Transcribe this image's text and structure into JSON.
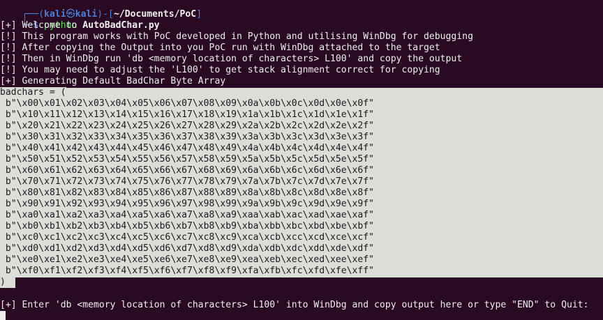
{
  "prompt": {
    "box_top_left": "┌──(",
    "user": "kali",
    "at_symbol": "㉿",
    "host": "kali",
    "box_mid": ")-[",
    "path": "~/Documents/PoC",
    "box_end": "]",
    "box_bottom": "└─",
    "dollar": "$",
    "command": "python",
    "argument": "AutoBadChar.py"
  },
  "output_lines": [
    "[+] Welcome to AutoBadChar...",
    "[!] This program works with PoC developed in Python and utilising WinDbg for debugging",
    "[!] After copying the Output into you PoC run with WinDbg attached to the target",
    "[!] Then in WinDbg run 'db <memory location of characters> L100' and copy the output",
    "[!] You may need to adjust the 'L100' to get stack alignment correct for copying",
    "[+] Generating Default BadChar Byte Array"
  ],
  "badchars_header": "badchars = (",
  "badchars_rows": [
    " b\"\\x00\\x01\\x02\\x03\\x04\\x05\\x06\\x07\\x08\\x09\\x0a\\x0b\\x0c\\x0d\\x0e\\x0f\"",
    " b\"\\x10\\x11\\x12\\x13\\x14\\x15\\x16\\x17\\x18\\x19\\x1a\\x1b\\x1c\\x1d\\x1e\\x1f\"",
    " b\"\\x20\\x21\\x22\\x23\\x24\\x25\\x26\\x27\\x28\\x29\\x2a\\x2b\\x2c\\x2d\\x2e\\x2f\"",
    " b\"\\x30\\x31\\x32\\x33\\x34\\x35\\x36\\x37\\x38\\x39\\x3a\\x3b\\x3c\\x3d\\x3e\\x3f\"",
    " b\"\\x40\\x41\\x42\\x43\\x44\\x45\\x46\\x47\\x48\\x49\\x4a\\x4b\\x4c\\x4d\\x4e\\x4f\"",
    " b\"\\x50\\x51\\x52\\x53\\x54\\x55\\x56\\x57\\x58\\x59\\x5a\\x5b\\x5c\\x5d\\x5e\\x5f\"",
    " b\"\\x60\\x61\\x62\\x63\\x64\\x65\\x66\\x67\\x68\\x69\\x6a\\x6b\\x6c\\x6d\\x6e\\x6f\"",
    " b\"\\x70\\x71\\x72\\x73\\x74\\x75\\x76\\x77\\x78\\x79\\x7a\\x7b\\x7c\\x7d\\x7e\\x7f\"",
    " b\"\\x80\\x81\\x82\\x83\\x84\\x85\\x86\\x87\\x88\\x89\\x8a\\x8b\\x8c\\x8d\\x8e\\x8f\"",
    " b\"\\x90\\x91\\x92\\x93\\x94\\x95\\x96\\x97\\x98\\x99\\x9a\\x9b\\x9c\\x9d\\x9e\\x9f\"",
    " b\"\\xa0\\xa1\\xa2\\xa3\\xa4\\xa5\\xa6\\xa7\\xa8\\xa9\\xaa\\xab\\xac\\xad\\xae\\xaf\"",
    " b\"\\xb0\\xb1\\xb2\\xb3\\xb4\\xb5\\xb6\\xb7\\xb8\\xb9\\xba\\xbb\\xbc\\xbd\\xbe\\xbf\"",
    " b\"\\xc0\\xc1\\xc2\\xc3\\xc4\\xc5\\xc6\\xc7\\xc8\\xc9\\xca\\xcb\\xcc\\xcd\\xce\\xcf\"",
    " b\"\\xd0\\xd1\\xd2\\xd3\\xd4\\xd5\\xd6\\xd7\\xd8\\xd9\\xda\\xdb\\xdc\\xdd\\xde\\xdf\"",
    " b\"\\xe0\\xe1\\xe2\\xe3\\xe4\\xe5\\xe6\\xe7\\xe8\\xe9\\xea\\xeb\\xec\\xed\\xee\\xef\"",
    " b\"\\xf0\\xf1\\xf2\\xf3\\xf4\\xf5\\xf6\\xf7\\xf8\\xf9\\xfa\\xfb\\xfc\\xfd\\xfe\\xff\""
  ],
  "badchars_footer": ")",
  "input_prompt": "[+] Enter 'db <memory location of characters> L100' into WinDbg and copy output here or type \"END\" to Quit:",
  "colors": {
    "background": "#2a0a22",
    "prompt_blue": "#4d7fd6",
    "command_green": "#5fd75f",
    "selection": "#dcdcd8",
    "text": "#eeeeee"
  }
}
